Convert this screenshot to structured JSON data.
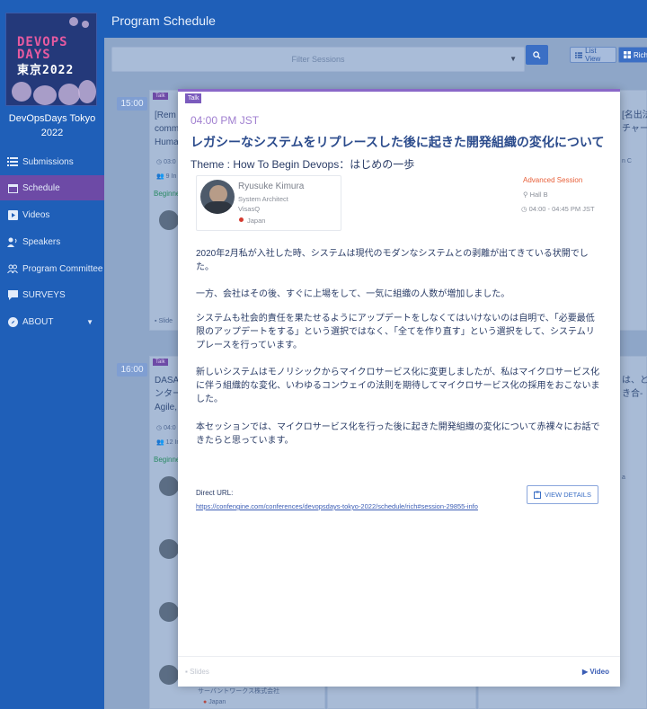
{
  "sidebar": {
    "logo_line1": "DEVOPS",
    "logo_line2": "DAYS",
    "logo_line3": "東京2022",
    "org_line1": "DevOpsDays Tokyo",
    "org_line2": "2022",
    "items": [
      {
        "label": "Submissions",
        "icon": "list-icon"
      },
      {
        "label": "Schedule",
        "icon": "calendar-icon",
        "active": true
      },
      {
        "label": "Videos",
        "icon": "play-icon"
      },
      {
        "label": "Speakers",
        "icon": "speaker-icon"
      },
      {
        "label": "Program Committee",
        "icon": "people-icon"
      },
      {
        "label": "SURVEYS",
        "icon": "survey-icon"
      },
      {
        "label": "ABOUT",
        "icon": "compass-icon"
      }
    ]
  },
  "header": {
    "title": "Program Schedule"
  },
  "filter": {
    "placeholder": "Filter Sessions",
    "list_view": "List View",
    "rich": "Rich"
  },
  "background": {
    "times": [
      "15:00",
      "16:00"
    ],
    "tag": "Talk",
    "card1": {
      "line1": "[Rem",
      "line2": "comm",
      "line3": "Huma",
      "time": "03:0",
      "attendees": "9 In",
      "level": "Beginne"
    },
    "card2": {
      "line1": "DASA",
      "line2": "ンター",
      "line3": "Agile,",
      "time": "04:0",
      "attendees": "12 In",
      "level": "Beginne"
    },
    "right1": {
      "line1": "[名出法",
      "line2": "チャー",
      "chip": "n C"
    },
    "right2": {
      "line1": "は、と",
      "line2": "き合-",
      "tail": "a"
    },
    "slides": "Slide",
    "company": "サーバントワークス株式会社",
    "country": "Japan"
  },
  "modal": {
    "tag": "Talk",
    "time": "04:00 PM JST",
    "title": "レガシーなシステムをリプレースした後に起きた開発組織の変化について",
    "theme": "Theme : How To Begin Devops：はじめの一歩",
    "speaker": {
      "name": "Ryusuke Kimura",
      "role": "System Architect",
      "company": "VisasQ",
      "country": "Japan"
    },
    "level": "Advanced Session",
    "room": "Hall B",
    "time_range": "04:00 - 04:45 PM JST",
    "paragraphs": [
      "2020年2月私が入社した時、システムは現代のモダンなシステムとの剥離が出てきている状開でした。",
      "一方、会社はその後、すぐに上場をして、一気に組織の人数が増加しました。",
      "システムも社会的責任を果たせるようにアップデートをしなくてはいけないのは自明で、「必要最低限のアップデートをする」という選択ではなく、「全てを作り直す」という選択をして、システムリプレースを行っています。",
      "新しいシステムはモノリシックからマイクロサービス化に変更しましたが、私はマイクロサービス化に伴う組織的な変化、いわゆるコンウェイの法則を期待してマイクロサービス化の採用をおこないました。",
      "本セッションでは、マイクロサービス化を行った後に起きた開発組織の変化について赤裸々にお話できたらと思っています。"
    ],
    "direct_url_label": "Direct URL:",
    "direct_url": "https://confengine.com/conferences/devopsdays-tokyo-2022/schedule/rich#session-29855-info",
    "view_details": "VIEW DETAILS",
    "slides": "Slides",
    "video": "Video"
  }
}
